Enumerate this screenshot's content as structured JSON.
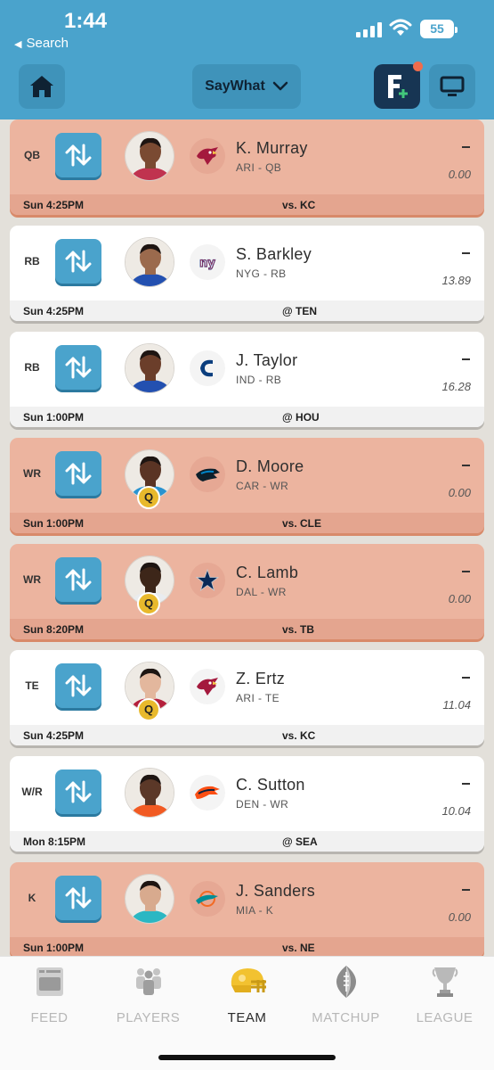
{
  "status": {
    "time": "1:44",
    "back_label": "Search",
    "battery": "55"
  },
  "header": {
    "team_name": "SayWhat"
  },
  "roster": [
    {
      "slot": "QB",
      "name": "K. Murray",
      "team_pos": "ARI - QB",
      "dash": "–",
      "points": "0.00",
      "game_time": "Sun 4:25PM",
      "opponent": "vs. KC",
      "status": "",
      "logo": "cardinals-logo",
      "style": "salmon"
    },
    {
      "slot": "RB",
      "name": "S. Barkley",
      "team_pos": "NYG - RB",
      "dash": "–",
      "points": "13.89",
      "game_time": "Sun 4:25PM",
      "opponent": "@ TEN",
      "status": "",
      "logo": "giants-logo",
      "style": "white"
    },
    {
      "slot": "RB",
      "name": "J. Taylor",
      "team_pos": "IND - RB",
      "dash": "–",
      "points": "16.28",
      "game_time": "Sun 1:00PM",
      "opponent": "@ HOU",
      "status": "",
      "logo": "colts-logo",
      "style": "white"
    },
    {
      "slot": "WR",
      "name": "D. Moore",
      "team_pos": "CAR - WR",
      "dash": "–",
      "points": "0.00",
      "game_time": "Sun 1:00PM",
      "opponent": "vs. CLE",
      "status": "Q",
      "logo": "panthers-logo",
      "style": "salmon"
    },
    {
      "slot": "WR",
      "name": "C. Lamb",
      "team_pos": "DAL - WR",
      "dash": "–",
      "points": "0.00",
      "game_time": "Sun 8:20PM",
      "opponent": "vs. TB",
      "status": "Q",
      "logo": "cowboys-logo",
      "style": "salmon"
    },
    {
      "slot": "TE",
      "name": "Z. Ertz",
      "team_pos": "ARI - TE",
      "dash": "–",
      "points": "11.04",
      "game_time": "Sun 4:25PM",
      "opponent": "vs. KC",
      "status": "Q",
      "logo": "cardinals-logo",
      "style": "white"
    },
    {
      "slot": "W/R",
      "name": "C. Sutton",
      "team_pos": "DEN - WR",
      "dash": "–",
      "points": "10.04",
      "game_time": "Mon 8:15PM",
      "opponent": "@ SEA",
      "status": "",
      "logo": "broncos-logo",
      "style": "white"
    },
    {
      "slot": "K",
      "name": "J. Sanders",
      "team_pos": "MIA - K",
      "dash": "–",
      "points": "0.00",
      "game_time": "Sun 1:00PM",
      "opponent": "vs. NE",
      "status": "",
      "logo": "dolphins-logo",
      "style": "salmon"
    }
  ],
  "nav": [
    {
      "label": "FEED",
      "icon": "feed-icon"
    },
    {
      "label": "PLAYERS",
      "icon": "players-icon"
    },
    {
      "label": "TEAM",
      "icon": "helmet-icon",
      "active": true
    },
    {
      "label": "MATCHUP",
      "icon": "football-icon"
    },
    {
      "label": "LEAGUE",
      "icon": "trophy-icon"
    }
  ],
  "colors": {
    "header": "#4aa3cc",
    "benched_card": "#ecb49f",
    "active_card": "#ffffff",
    "accent": "#173553",
    "injury": "#e8b92c"
  }
}
